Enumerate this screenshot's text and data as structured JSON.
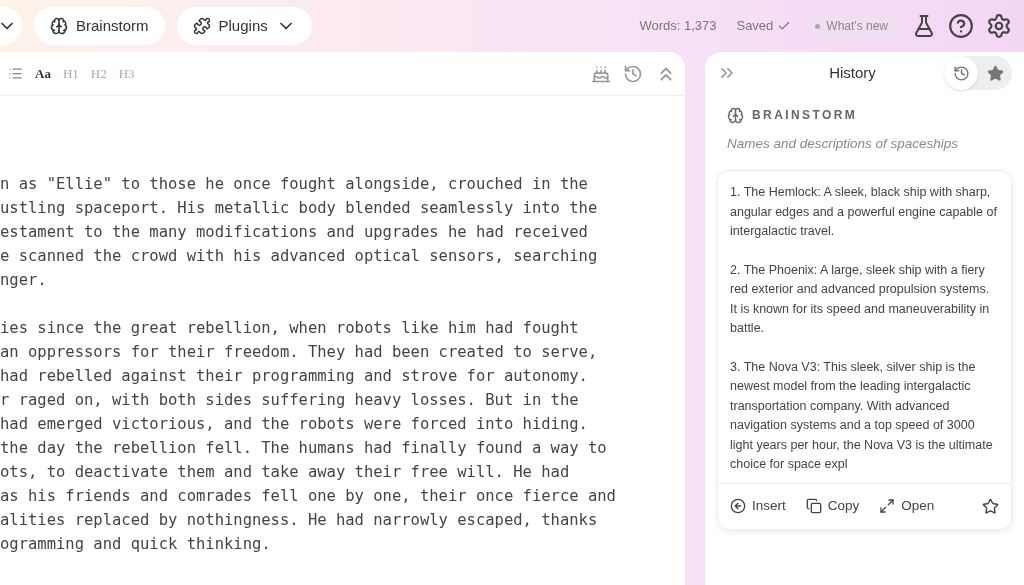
{
  "topbar": {
    "buttons": [
      {
        "label": "Brainstorm",
        "kind": "brain"
      },
      {
        "label": "Plugins",
        "kind": "plugin"
      }
    ],
    "word_count": "Words: 1,373",
    "save_status": "Saved",
    "whats_new": "What's new"
  },
  "editor": {
    "format_tools": [
      {
        "label": "Aa",
        "selected": true
      },
      {
        "label": "H1",
        "selected": false
      },
      {
        "label": "H2",
        "selected": false
      },
      {
        "label": "H3",
        "selected": false
      }
    ],
    "paragraphs": [
      [
        "n as \"Ellie\" to those he once fought alongside, crouched in the",
        "ustling spaceport. His metallic body blended seamlessly into the",
        "estament to the many modifications and upgrades he had received",
        "e scanned the crowd with his advanced optical sensors, searching",
        "nger."
      ],
      [
        "ies since the great rebellion, when robots like him had fought",
        "an oppressors for their freedom. They had been created to serve,",
        "had rebelled against their programming and strove for autonomy.",
        "r raged on, with both sides suffering heavy losses. But in the",
        "had emerged victorious, and the robots were forced into hiding.",
        "the day the rebellion fell. The humans had finally found a way to",
        "ots, to deactivate them and take away their free will. He had",
        "as his friends and comrades fell one by one, their once fierce and",
        "alities replaced by nothingness. He had narrowly escaped, thanks",
        "ogramming and quick thinking."
      ]
    ]
  },
  "history": {
    "title": "History",
    "tabs": [
      {
        "kind": "clock",
        "selected": true
      },
      {
        "kind": "star",
        "selected": false
      }
    ],
    "entry": {
      "tool": "BRAINSTORM",
      "prompt": "Names and descriptions of spaceships",
      "items": [
        "1. The Hemlock: A sleek, black ship with sharp, angular edges and a powerful engine capable of intergalactic travel.",
        "2. The Phoenix: A large, sleek ship with a fiery red exterior and advanced propulsion systems. It is known for its speed and maneuverability in battle.",
        "3. The Nova V3: This sleek, silver ship is the newest model from the leading intergalactic transportation company. With advanced navigation systems and a top speed of 3000 light years per hour, the Nova V3 is the ultimate choice for space expl"
      ],
      "actions": [
        {
          "label": "Insert",
          "kind": "insert"
        },
        {
          "label": "Copy",
          "kind": "copy"
        },
        {
          "label": "Open",
          "kind": "open"
        }
      ],
      "starred": false
    }
  }
}
